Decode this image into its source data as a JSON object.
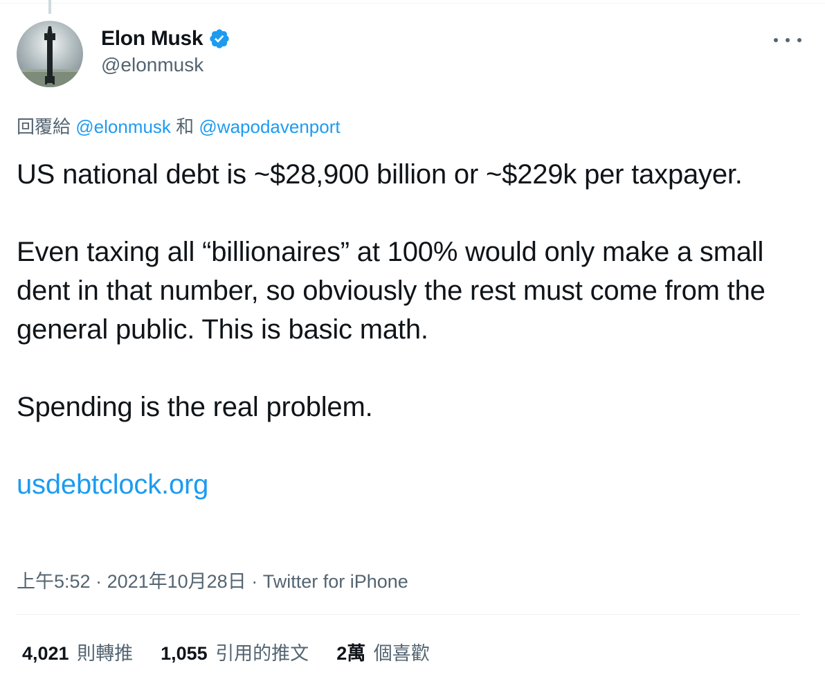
{
  "tweet": {
    "author": {
      "display_name": "Elon Musk",
      "handle": "@elonmusk",
      "verified": true
    },
    "reply_context": {
      "prefix": "回覆給",
      "mention_1": "@elonmusk",
      "joiner": "和",
      "mention_2": "@wapodavenport"
    },
    "text": {
      "line1": "US national debt is ~$28,900 billion or ~$229k per taxpayer.",
      "line2": "Even taxing all “billionaires” at 100% would only make a small dent in that number, so obviously the rest must come from the general public. This is basic math.",
      "line3": "Spending is the real problem.",
      "link": "usdebtclock.org"
    },
    "meta": {
      "time": "上午5:52",
      "separator": " · ",
      "date": "2021年10月28日",
      "source": "Twitter for iPhone"
    },
    "stats": {
      "retweets_count": "4,021",
      "retweets_label": "則轉推",
      "quotes_count": "1,055",
      "quotes_label": "引用的推文",
      "likes_count": "2萬",
      "likes_label": "個喜歡"
    }
  },
  "colors": {
    "accent": "#1d9bf0",
    "text_primary": "#0f1419",
    "text_secondary": "#536471",
    "divider": "#eff3f4"
  },
  "icons": {
    "verified": "verified-badge-icon",
    "more": "more-horizontal-icon"
  }
}
